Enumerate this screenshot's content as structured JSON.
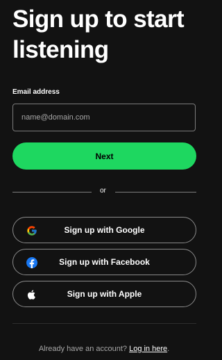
{
  "page": {
    "title": "Sign up to start listening"
  },
  "form": {
    "email_label": "Email address",
    "email_value": "",
    "email_placeholder": "name@domain.com",
    "next_label": "Next",
    "divider_text": "or"
  },
  "social": [
    {
      "label": "Sign up with Google",
      "icon": "google-icon"
    },
    {
      "label": "Sign up with Facebook",
      "icon": "facebook-icon"
    },
    {
      "label": "Sign up with Apple",
      "icon": "apple-icon"
    }
  ],
  "footer": {
    "prompt": "Already have an account?",
    "link_label": "Log in here",
    "suffix": "."
  },
  "colors": {
    "background": "#121212",
    "accent": "#1ed760",
    "text": "#ffffff",
    "muted_text": "#a7a7a7",
    "border": "#7c7c7c"
  }
}
